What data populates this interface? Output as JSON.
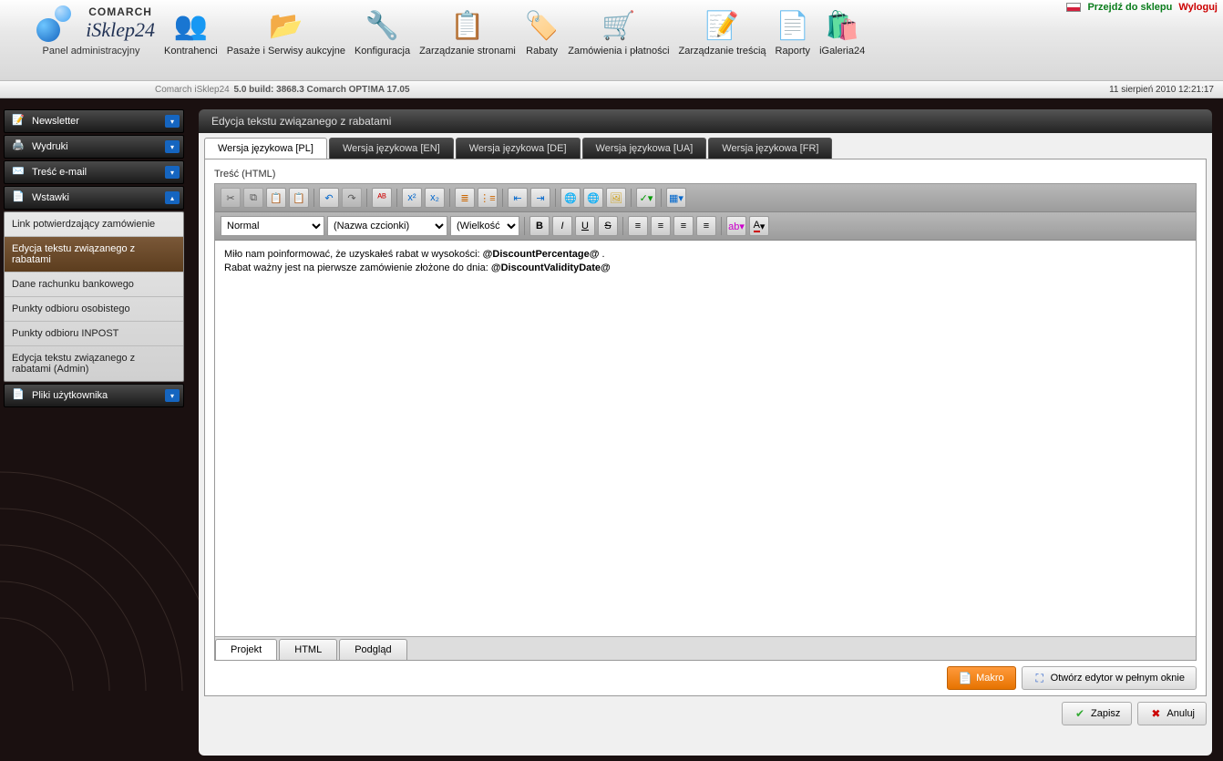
{
  "top": {
    "shop_link": "Przejdź do sklepu",
    "logout": "Wyloguj",
    "brand1": "COMARCH",
    "brand2": "iSklep24",
    "panel_sub": "Panel administracyjny"
  },
  "menu": [
    {
      "label": "Kontrahenci",
      "icon": "👥"
    },
    {
      "label": "Pasaże i Serwisy aukcyjne",
      "icon": "📂"
    },
    {
      "label": "Konfiguracja",
      "icon": "🔧"
    },
    {
      "label": "Zarządzanie stronami",
      "icon": "📋"
    },
    {
      "label": "Rabaty",
      "icon": "🏷️"
    },
    {
      "label": "Zamówienia i płatności",
      "icon": "🛒"
    },
    {
      "label": "Zarządzanie treścią",
      "icon": "📝"
    },
    {
      "label": "Raporty",
      "icon": "📄"
    },
    {
      "label": "iGaleria24",
      "icon": "🛍️"
    }
  ],
  "infobar": {
    "left_prefix": "Comarch iSklep24",
    "left_ver": "5.0 build: 3868.3  Comarch OPT!MA 17.05",
    "right": "11 sierpień 2010 12:21:17"
  },
  "sidebar": {
    "sections": [
      {
        "label": "Newsletter",
        "icon": "📝",
        "open": false
      },
      {
        "label": "Wydruki",
        "icon": "🖨️",
        "open": false
      },
      {
        "label": "Treść e-mail",
        "icon": "✉️",
        "open": false
      },
      {
        "label": "Wstawki",
        "icon": "📄",
        "open": true
      },
      {
        "label": "Pliki użytkownika",
        "icon": "📄",
        "open": false
      }
    ],
    "wstawki_items": [
      "Link potwierdzający zamówienie",
      "Edycja tekstu związanego z rabatami",
      "Dane rachunku bankowego",
      "Punkty odbioru osobistego",
      "Punkty odbioru INPOST",
      "Edycja tekstu związanego z rabatami (Admin)"
    ],
    "active_index": 1
  },
  "panel": {
    "title": "Edycja tekstu związanego z rabatami",
    "lang_tabs": [
      "Wersja językowa [PL]",
      "Wersja językowa [EN]",
      "Wersja językowa [DE]",
      "Wersja językowa [UA]",
      "Wersja językowa [FR]"
    ],
    "active_lang": 0,
    "fieldset_label": "Treść (HTML)"
  },
  "editor": {
    "format_sel": "Normal",
    "font_sel": "(Nazwa czcionki)",
    "size_sel": "(Wielkość cz",
    "content_line1_pre": "Miło nam poinformować, że uzyskałeś rabat w wysokości: ",
    "content_line1_bold": "@DiscountPercentage@",
    "content_line1_post": " .",
    "content_line2_pre": "Rabat ważny jest na pierwsze zamówienie złożone do dnia: ",
    "content_line2_bold": "@DiscountValidityDate@",
    "mode_tabs": [
      "Projekt",
      "HTML",
      "Podgląd"
    ],
    "active_mode": 0
  },
  "buttons": {
    "makro": "Makro",
    "full_editor": "Otwórz edytor w pełnym oknie",
    "save": "Zapisz",
    "cancel": "Anuluj"
  }
}
